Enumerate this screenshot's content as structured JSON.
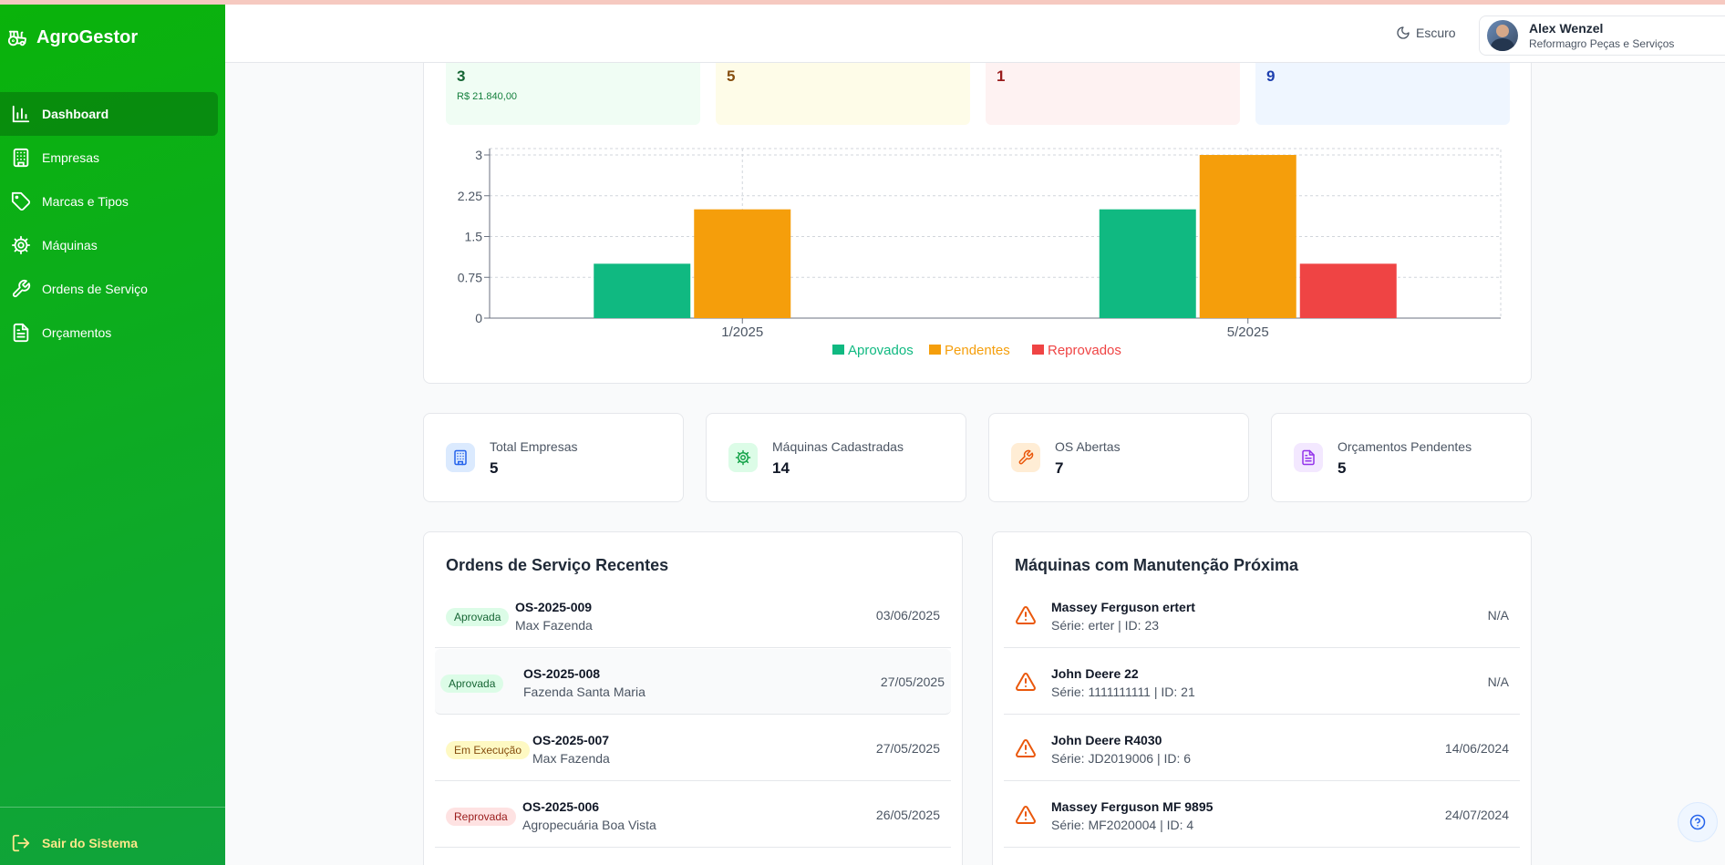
{
  "app": {
    "name": "AgroGestor"
  },
  "sidebar": {
    "items": [
      {
        "label": "Dashboard",
        "icon": "bar-chart-icon",
        "active": true
      },
      {
        "label": "Empresas",
        "icon": "building-icon"
      },
      {
        "label": "Marcas e Tipos",
        "icon": "tag-icon"
      },
      {
        "label": "Máquinas",
        "icon": "cog-icon"
      },
      {
        "label": "Ordens de Serviço",
        "icon": "wrench-icon"
      },
      {
        "label": "Orçamentos",
        "icon": "document-icon"
      }
    ],
    "logout": "Sair do Sistema"
  },
  "header": {
    "theme_label": "Escuro",
    "user_name": "Alex Wenzel",
    "user_company": "Reformagro Peças e Serviços"
  },
  "summary": [
    {
      "value": "3",
      "sub": "R$ 21.840,00",
      "color": "#166534",
      "bg": "#f0fdf4"
    },
    {
      "value": "5",
      "sub": "",
      "color": "#854d0e",
      "bg": "#fefce8"
    },
    {
      "value": "1",
      "sub": "",
      "color": "#991b1b",
      "bg": "#fef2f2"
    },
    {
      "value": "9",
      "sub": "",
      "color": "#1e40af",
      "bg": "#eff6ff"
    }
  ],
  "chart_data": {
    "type": "bar",
    "categories": [
      "1/2025",
      "5/2025"
    ],
    "series": [
      {
        "name": "Aprovados",
        "values": [
          1,
          2
        ],
        "color": "#10b981"
      },
      {
        "name": "Pendentes",
        "values": [
          2,
          3
        ],
        "color": "#f59e0b"
      },
      {
        "name": "Reprovados",
        "values": [
          0,
          1
        ],
        "color": "#ef4444"
      }
    ],
    "yticks": [
      "0",
      "0.75",
      "1.5",
      "2.25",
      "3"
    ],
    "ylim": [
      0,
      3
    ],
    "grid": true,
    "legend": "bottom"
  },
  "stats": [
    {
      "label": "Total Empresas",
      "value": "5",
      "icon": "building-icon",
      "color": "#2563eb",
      "bg": "#dbeafe"
    },
    {
      "label": "Máquinas Cadastradas",
      "value": "14",
      "icon": "cog-icon",
      "color": "#16a34a",
      "bg": "#dcfce7"
    },
    {
      "label": "OS Abertas",
      "value": "7",
      "icon": "wrench-icon",
      "color": "#ea580c",
      "bg": "#ffedd5"
    },
    {
      "label": "Orçamentos Pendentes",
      "value": "5",
      "icon": "document-icon",
      "color": "#9333ea",
      "bg": "#f3e8ff"
    }
  ],
  "recent_orders": {
    "title": "Ordens de Serviço Recentes",
    "items": [
      {
        "status": "Aprovada",
        "code": "OS-2025-009",
        "client": "Max Fazenda",
        "date": "03/06/2025",
        "badge_bg": "#dcfce7",
        "badge_color": "#166534"
      },
      {
        "status": "Aprovada",
        "code": "OS-2025-008",
        "client": "Fazenda Santa Maria",
        "date": "27/05/2025",
        "badge_bg": "#dcfce7",
        "badge_color": "#166534"
      },
      {
        "status": "Em Execução",
        "code": "OS-2025-007",
        "client": "Max Fazenda",
        "date": "27/05/2025",
        "badge_bg": "#fef9c3",
        "badge_color": "#854d0e"
      },
      {
        "status": "Reprovada",
        "code": "OS-2025-006",
        "client": "Agropecuária Boa Vista",
        "date": "26/05/2025",
        "badge_bg": "#fee2e2",
        "badge_color": "#991b1b"
      }
    ]
  },
  "maintenance": {
    "title": "Máquinas com Manutenção Próxima",
    "items": [
      {
        "name": "Massey Ferguson ertert",
        "detail": "Série: erter | ID: 23",
        "date": "N/A"
      },
      {
        "name": "John Deere 22",
        "detail": "Série: 1111111111 | ID: 21",
        "date": "N/A"
      },
      {
        "name": "John Deere R4030",
        "detail": "Série: JD2019006 | ID: 6",
        "date": "14/06/2024"
      },
      {
        "name": "Massey Ferguson MF 9895",
        "detail": "Série: MF2020004 | ID: 4",
        "date": "24/07/2024"
      }
    ]
  }
}
